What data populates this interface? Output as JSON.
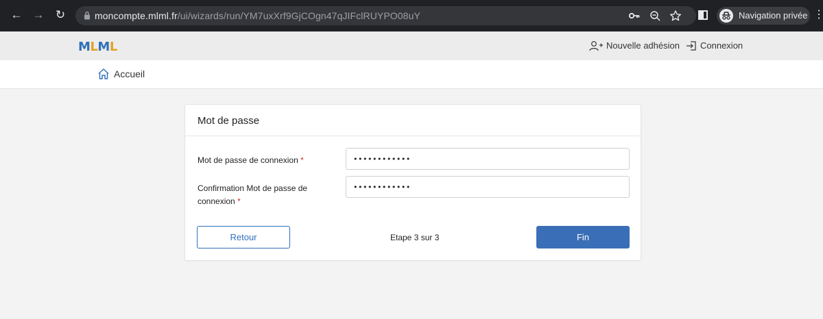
{
  "browser": {
    "back_icon": "arrow-left-icon",
    "forward_icon": "arrow-right-icon",
    "reload_icon": "reload-icon",
    "url_host": "moncompte.mlml.fr",
    "url_path": "/ui/wizards/run/YM7uxXrf9GjCOgn47qJIFclRUYPO08uY",
    "incognito_label": "Navigation privée"
  },
  "header": {
    "logo_part1": "M",
    "logo_part2": "L",
    "logo_part3": "M",
    "logo_part4": "L",
    "new_membership_label": "Nouvelle adhésion",
    "login_label": "Connexion"
  },
  "breadcrumb": {
    "home_label": "Accueil"
  },
  "form": {
    "title": "Mot de passe",
    "password_label": "Mot de passe de connexion",
    "password_value": "••••••••••••",
    "confirm_label": "Confirmation Mot de passe de connexion",
    "confirm_value": "••••••••••••",
    "required_marker": "*",
    "back_label": "Retour",
    "step_text": "Etape 3 sur 3",
    "finish_label": "Fin"
  },
  "colors": {
    "brand_blue": "#2f6fba",
    "brand_yellow": "#e4a21c",
    "primary_button": "#3a6fb7",
    "required": "#d32f2f"
  }
}
